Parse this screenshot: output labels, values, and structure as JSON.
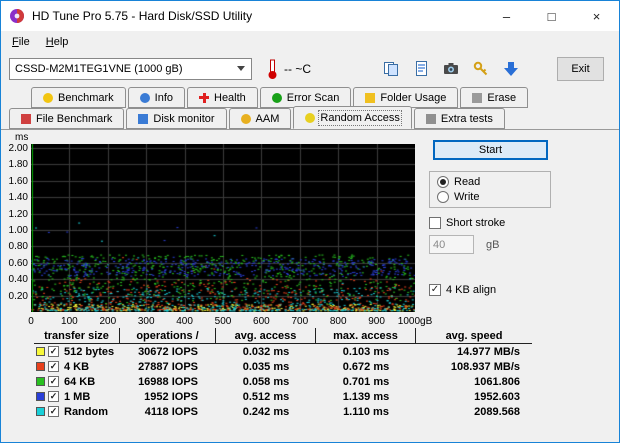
{
  "window": {
    "title": "HD Tune Pro 5.75 - Hard Disk/SSD Utility"
  },
  "window_controls": {
    "minimize": "–",
    "maximize": "□",
    "close": "×"
  },
  "menu": {
    "items": [
      {
        "label": "File"
      },
      {
        "label": "Help"
      }
    ]
  },
  "toolbar": {
    "drive_select": "CSSD-M2M1TEG1VNE (1000 gB)",
    "temperature": "-- ~C",
    "icon_buttons": [
      "copy",
      "report",
      "camera",
      "keys",
      "save"
    ],
    "exit_label": "Exit"
  },
  "tabs": {
    "rows": [
      [
        {
          "label": "Benchmark",
          "icon": "benchmark-icon",
          "color": "#f2c511",
          "shape": "circle"
        },
        {
          "label": "Info",
          "icon": "info-icon",
          "color": "#3a7bd5",
          "shape": "circle"
        },
        {
          "label": "Health",
          "icon": "health-icon",
          "color": "#e02020",
          "shape": "plus"
        },
        {
          "label": "Error Scan",
          "icon": "error-scan-icon",
          "color": "#18a018",
          "shape": "circle"
        },
        {
          "label": "Folder Usage",
          "icon": "folder-usage-icon",
          "color": "#f0c020",
          "shape": "square"
        },
        {
          "label": "Erase",
          "icon": "erase-icon",
          "color": "#9a9a9a",
          "shape": "square"
        }
      ],
      [
        {
          "label": "File Benchmark",
          "icon": "file-benchmark-icon",
          "color": "#d04040",
          "shape": "square"
        },
        {
          "label": "Disk monitor",
          "icon": "disk-monitor-icon",
          "color": "#3a7bd5",
          "shape": "square"
        },
        {
          "label": "AAM",
          "icon": "aam-icon",
          "color": "#e8b020",
          "shape": "circle"
        },
        {
          "label": "Random Access",
          "icon": "random-access-icon",
          "color": "#e8d020",
          "shape": "circle",
          "active": true
        },
        {
          "label": "Extra tests",
          "icon": "extra-tests-icon",
          "color": "#909090",
          "shape": "square"
        }
      ]
    ]
  },
  "controls": {
    "start_label": "Start",
    "read_label": "Read",
    "write_label": "Write",
    "read_selected": true,
    "short_stroke_label": "Short stroke",
    "short_stroke_checked": false,
    "short_stroke_value": "40",
    "short_stroke_unit": "gB",
    "align_label": "4 KB align",
    "align_checked": true
  },
  "chart_data": {
    "type": "scatter",
    "title": "Random Access: access time (ms) vs disk position (gB)",
    "ylabel_unit": "ms",
    "xlabel_unit": "gB",
    "y_ticks": [
      "2.00",
      "1.80",
      "1.60",
      "1.40",
      "1.20",
      "1.00",
      "0.80",
      "0.60",
      "0.40",
      "0.20"
    ],
    "x_ticks": [
      "0",
      "100",
      "200",
      "300",
      "400",
      "500",
      "600",
      "700",
      "800",
      "900",
      "1000gB"
    ],
    "x_range": [
      0,
      1000
    ],
    "y_range": [
      0,
      2.05
    ],
    "grid": true,
    "plot_bg": "#000000",
    "grid_color": "#3c3c3c",
    "progress_line_color": "#00b000",
    "series": [
      {
        "name": "512 bytes",
        "color": "#f8f83a",
        "avg_ms": 0.032,
        "max_ms": 0.103,
        "band": [
          0.02,
          0.1
        ],
        "points": 320,
        "skew": 1.6
      },
      {
        "name": "4 KB",
        "color": "#e8401c",
        "avg_ms": 0.035,
        "max_ms": 0.672,
        "band": [
          0.03,
          0.42
        ],
        "points": 520,
        "skew": 2.2
      },
      {
        "name": "64 KB",
        "color": "#28c020",
        "avg_ms": 0.058,
        "max_ms": 0.701,
        "band": [
          0.07,
          0.7
        ],
        "points": 640,
        "skew": 0.6
      },
      {
        "name": "1 MB",
        "color": "#2a3fd8",
        "avg_ms": 0.512,
        "max_ms": 1.139,
        "band": [
          0.44,
          0.66
        ],
        "points": 420,
        "skew": 1.0
      },
      {
        "name": "Random",
        "color": "#18cfd8",
        "avg_ms": 0.242,
        "max_ms": 1.11,
        "band": [
          0.02,
          0.3
        ],
        "points": 480,
        "skew": 2.0
      }
    ]
  },
  "table": {
    "headers": [
      "transfer size",
      "operations /",
      "avg. access",
      "max. access",
      "avg. speed"
    ],
    "rows": [
      {
        "color": "#f8f83a",
        "checked": true,
        "size": "512 bytes",
        "ops": "30672 IOPS",
        "avg": "0.032 ms",
        "max": "0.103 ms",
        "speed": "14.977 MB/s"
      },
      {
        "color": "#e8401c",
        "checked": true,
        "size": "4 KB",
        "ops": "27887 IOPS",
        "avg": "0.035 ms",
        "max": "0.672 ms",
        "speed": "108.937 MB/s"
      },
      {
        "color": "#28c020",
        "checked": true,
        "size": "64 KB",
        "ops": "16988 IOPS",
        "avg": "0.058 ms",
        "max": "0.701 ms",
        "speed": "1061.806"
      },
      {
        "color": "#2a3fd8",
        "checked": true,
        "size": "1 MB",
        "ops": "1952 IOPS",
        "avg": "0.512 ms",
        "max": "1.139 ms",
        "speed": "1952.603"
      },
      {
        "color": "#18cfd8",
        "checked": true,
        "size": "Random",
        "ops": "4118 IOPS",
        "avg": "0.242 ms",
        "max": "1.110 ms",
        "speed": "2089.568"
      }
    ]
  }
}
